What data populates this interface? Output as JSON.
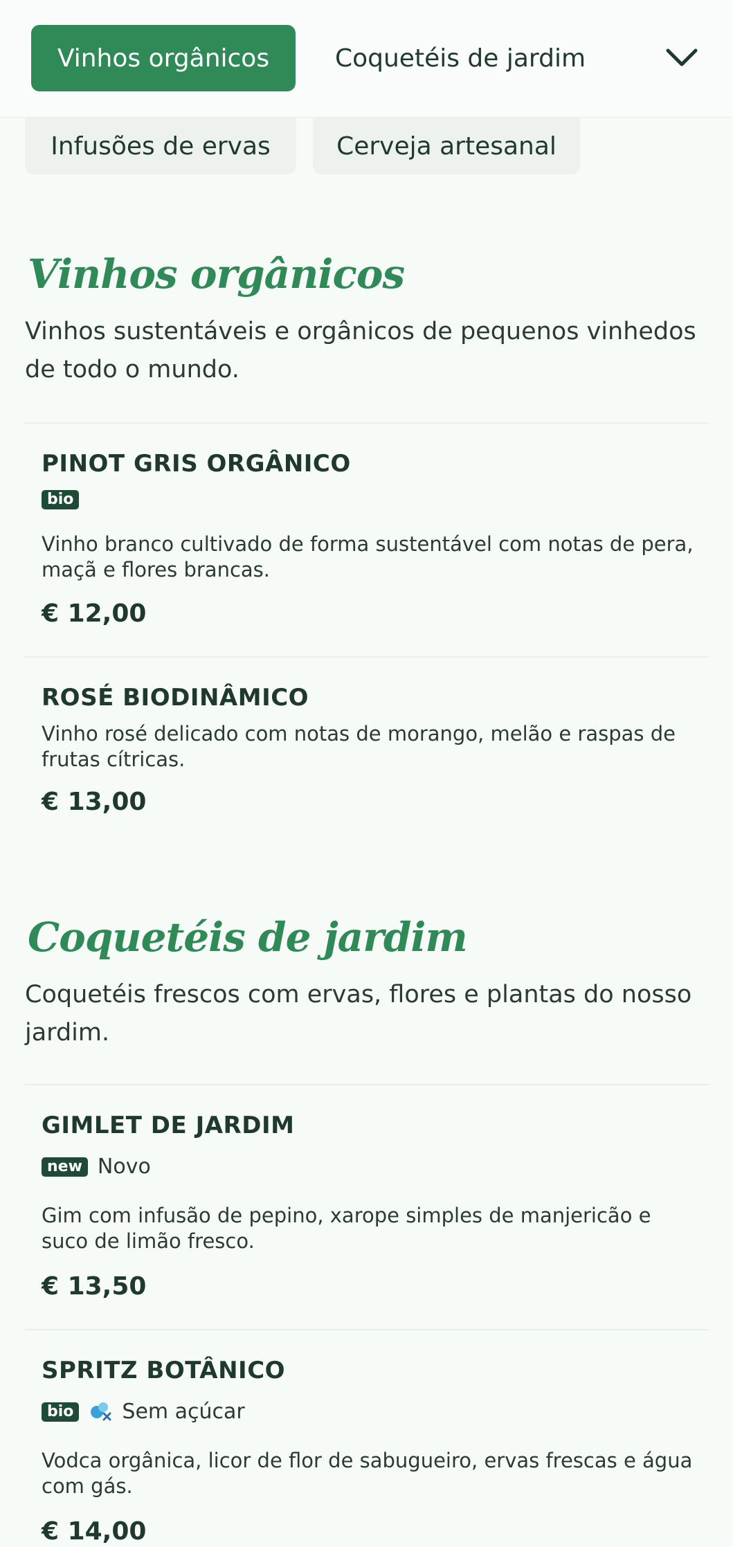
{
  "nav": {
    "tabs": [
      {
        "label": "Vinhos orgânicos",
        "active": true
      },
      {
        "label": "Coquetéis de jardim",
        "active": false
      }
    ],
    "more_tabs": [
      {
        "label": "Infusões de ervas"
      },
      {
        "label": "Cerveja artesanal"
      }
    ],
    "expand_icon": "chevron-down-icon"
  },
  "colors": {
    "accent": "#2f8a57",
    "text": "#1f3a2d",
    "tag_bg": "#1f4a35",
    "background": "#f7fbf8"
  },
  "sections": [
    {
      "title": "Vinhos orgânicos",
      "description": "Vinhos sustentáveis e orgânicos de pequenos vinhedos de todo o mundo.",
      "items": [
        {
          "name": "PINOT GRIS ORGÂNICO",
          "tag": "bio",
          "description": "Vinho branco cultivado de forma sustentável com notas de pera, maçã e flores brancas.",
          "price": "€ 12,00"
        },
        {
          "name": "ROSÉ BIODINÂMICO",
          "description": "Vinho rosé delicado com notas de morango, melão e raspas de frutas cítricas.",
          "price": "€ 13,00"
        }
      ]
    },
    {
      "title": "Coquetéis de jardim",
      "description": "Coquetéis frescos com ervas, flores e plantas do nosso jardim.",
      "items": [
        {
          "name": "GIMLET DE JARDIM",
          "tag": "new",
          "tag_text": "Novo",
          "description": "Gim com infusão de pepino, xarope simples de manjericão e suco de limão fresco.",
          "price": "€ 13,50"
        },
        {
          "name": "SPRITZ BOTÂNICO",
          "tag": "bio",
          "icon": "sugar-free-icon",
          "tag_text": "Sem açúcar",
          "description": "Vodca orgânica, licor de flor de sabugueiro, ervas frescas e água com gás.",
          "price": "€ 14,00"
        }
      ]
    }
  ]
}
